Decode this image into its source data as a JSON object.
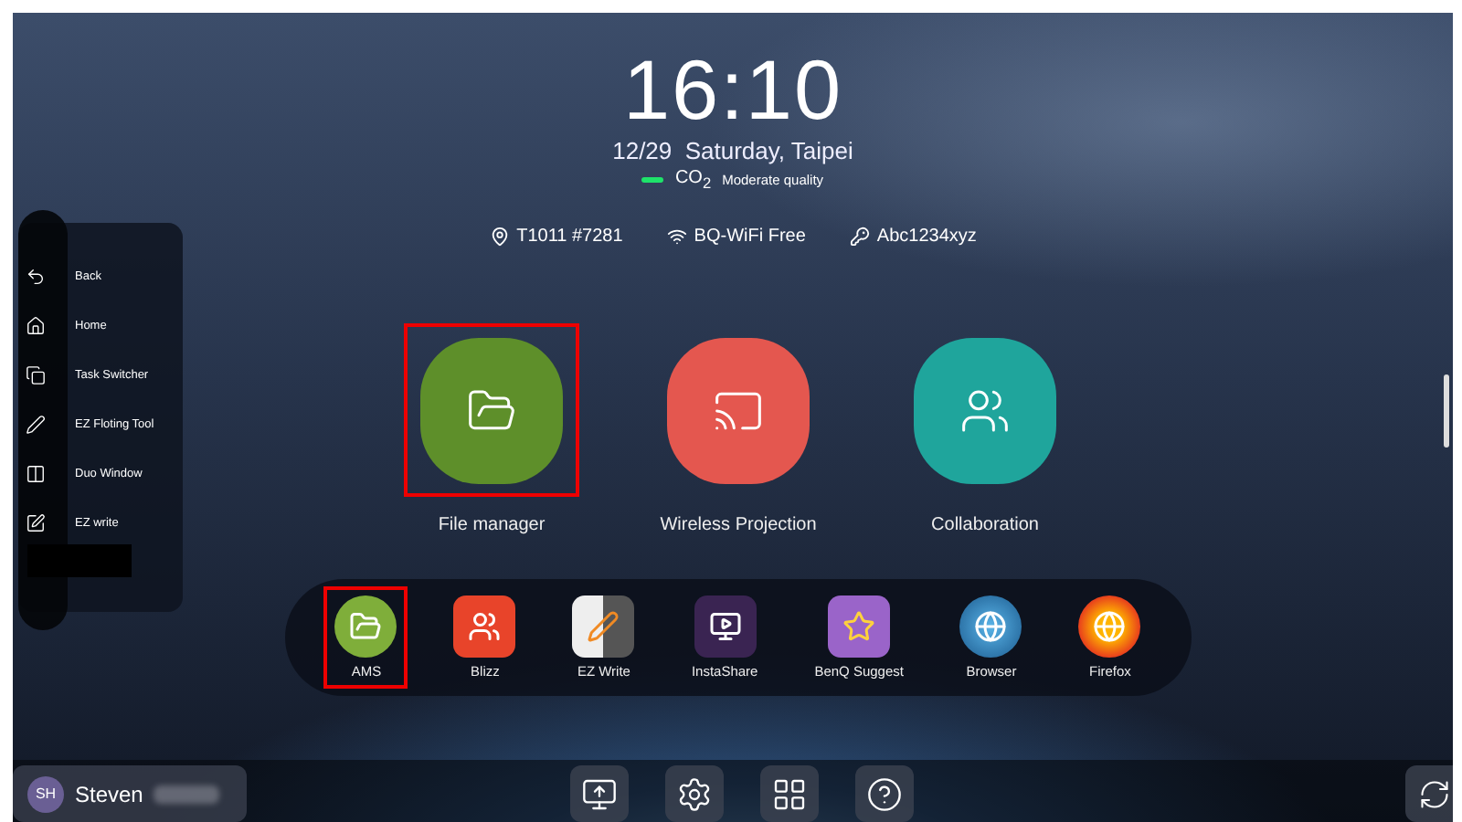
{
  "clock": {
    "time": "16:10",
    "date": "12/29  Saturday, Taipei",
    "air": {
      "label": "CO",
      "subscript": "2",
      "quality": "Moderate quality",
      "color": "#1ee36a"
    }
  },
  "info": [
    {
      "kind": "room",
      "text": "T1011 #7281"
    },
    {
      "kind": "wifi",
      "text": "BQ-WiFi Free"
    },
    {
      "kind": "password",
      "text": "Abc1234xyz"
    }
  ],
  "sidebar": {
    "items": [
      {
        "kind": "back",
        "label": "Back"
      },
      {
        "kind": "home",
        "label": "Home"
      },
      {
        "kind": "tasks",
        "label": "Task Switcher"
      },
      {
        "kind": "pen",
        "label": "EZ Floting Tool"
      },
      {
        "kind": "duo",
        "label": "Duo Window"
      },
      {
        "kind": "write",
        "label": "EZ write"
      }
    ]
  },
  "tiles": [
    {
      "kind": "files",
      "label": "File manager",
      "color": "#5e8f2a",
      "highlighted": true
    },
    {
      "kind": "projection",
      "label": "Wireless Projection",
      "color": "#e4574f",
      "highlighted": false
    },
    {
      "kind": "collab",
      "label": "Collaboration",
      "color": "#1fa59c",
      "highlighted": false
    }
  ],
  "dock": [
    {
      "kind": "ams",
      "label": "AMS",
      "highlighted": true
    },
    {
      "kind": "blizz",
      "label": "Blizz",
      "highlighted": false
    },
    {
      "kind": "ezwrite",
      "label": "EZ Write",
      "highlighted": false
    },
    {
      "kind": "instashare",
      "label": "InstaShare",
      "highlighted": false
    },
    {
      "kind": "suggest",
      "label": "BenQ Suggest",
      "highlighted": false
    },
    {
      "kind": "browser",
      "label": "Browser",
      "highlighted": false
    },
    {
      "kind": "firefox",
      "label": "Firefox",
      "highlighted": false
    }
  ],
  "user": {
    "initials": "SH",
    "name": "Steven"
  },
  "toolbar": [
    {
      "kind": "share"
    },
    {
      "kind": "settings"
    },
    {
      "kind": "apps"
    },
    {
      "kind": "help"
    }
  ]
}
